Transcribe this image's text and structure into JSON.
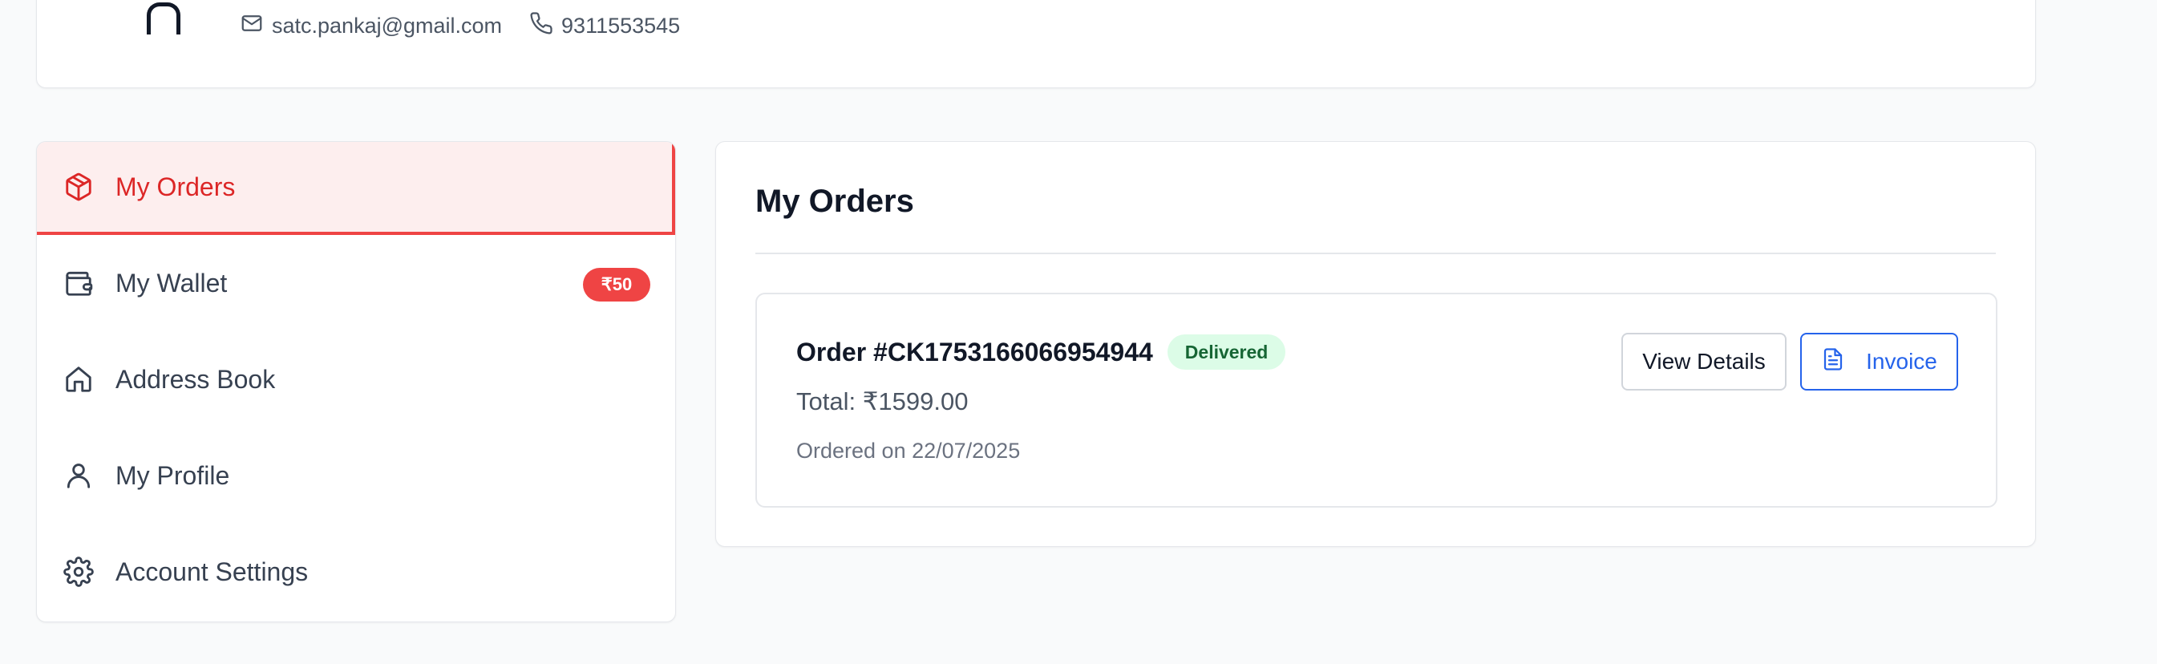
{
  "profile": {
    "email": "satc.pankaj@gmail.com",
    "phone": "9311553545",
    "email_icon": "mail-icon",
    "phone_icon": "phone-icon"
  },
  "sidebar": {
    "items": [
      {
        "label": "My Orders",
        "icon": "package-icon",
        "active": true
      },
      {
        "label": "My Wallet",
        "icon": "wallet-icon",
        "badge": "₹50"
      },
      {
        "label": "Address Book",
        "icon": "home-icon"
      },
      {
        "label": "My Profile",
        "icon": "user-icon"
      },
      {
        "label": "Account Settings",
        "icon": "gear-icon"
      }
    ]
  },
  "main": {
    "title": "My Orders",
    "orders": [
      {
        "number": "Order #CK1753166066954944",
        "status": "Delivered",
        "total": "Total: ₹1599.00",
        "date": "Ordered on 22/07/2025",
        "view_label": "View Details",
        "invoice_label": "Invoice"
      }
    ]
  },
  "colors": {
    "accent_red": "#ef4444",
    "active_bg": "#fdeeee",
    "success_bg": "#dcfce7",
    "success_text": "#166534",
    "primary_blue": "#2563eb"
  }
}
